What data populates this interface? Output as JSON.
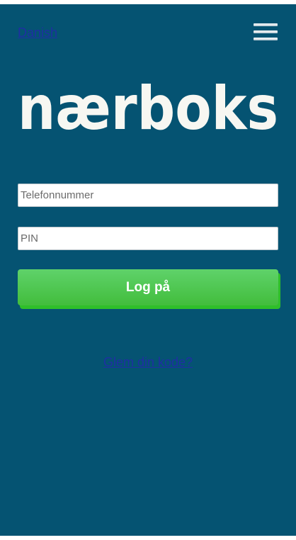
{
  "header": {
    "language_link": "Danish",
    "menu_icon": "hamburger-menu-icon"
  },
  "brand": {
    "logo_text": "nærboks",
    "logo_color": "#f7f7f2"
  },
  "login_form": {
    "phone_placeholder": "Telefonnummer",
    "phone_value": "",
    "pin_placeholder": "PIN",
    "pin_value": "",
    "submit_label": "Log på"
  },
  "footer": {
    "forgot_link": "Glem din kode?"
  },
  "colors": {
    "background": "#055372",
    "button_green": "#4ec94f",
    "link": "#1f2fa3"
  }
}
